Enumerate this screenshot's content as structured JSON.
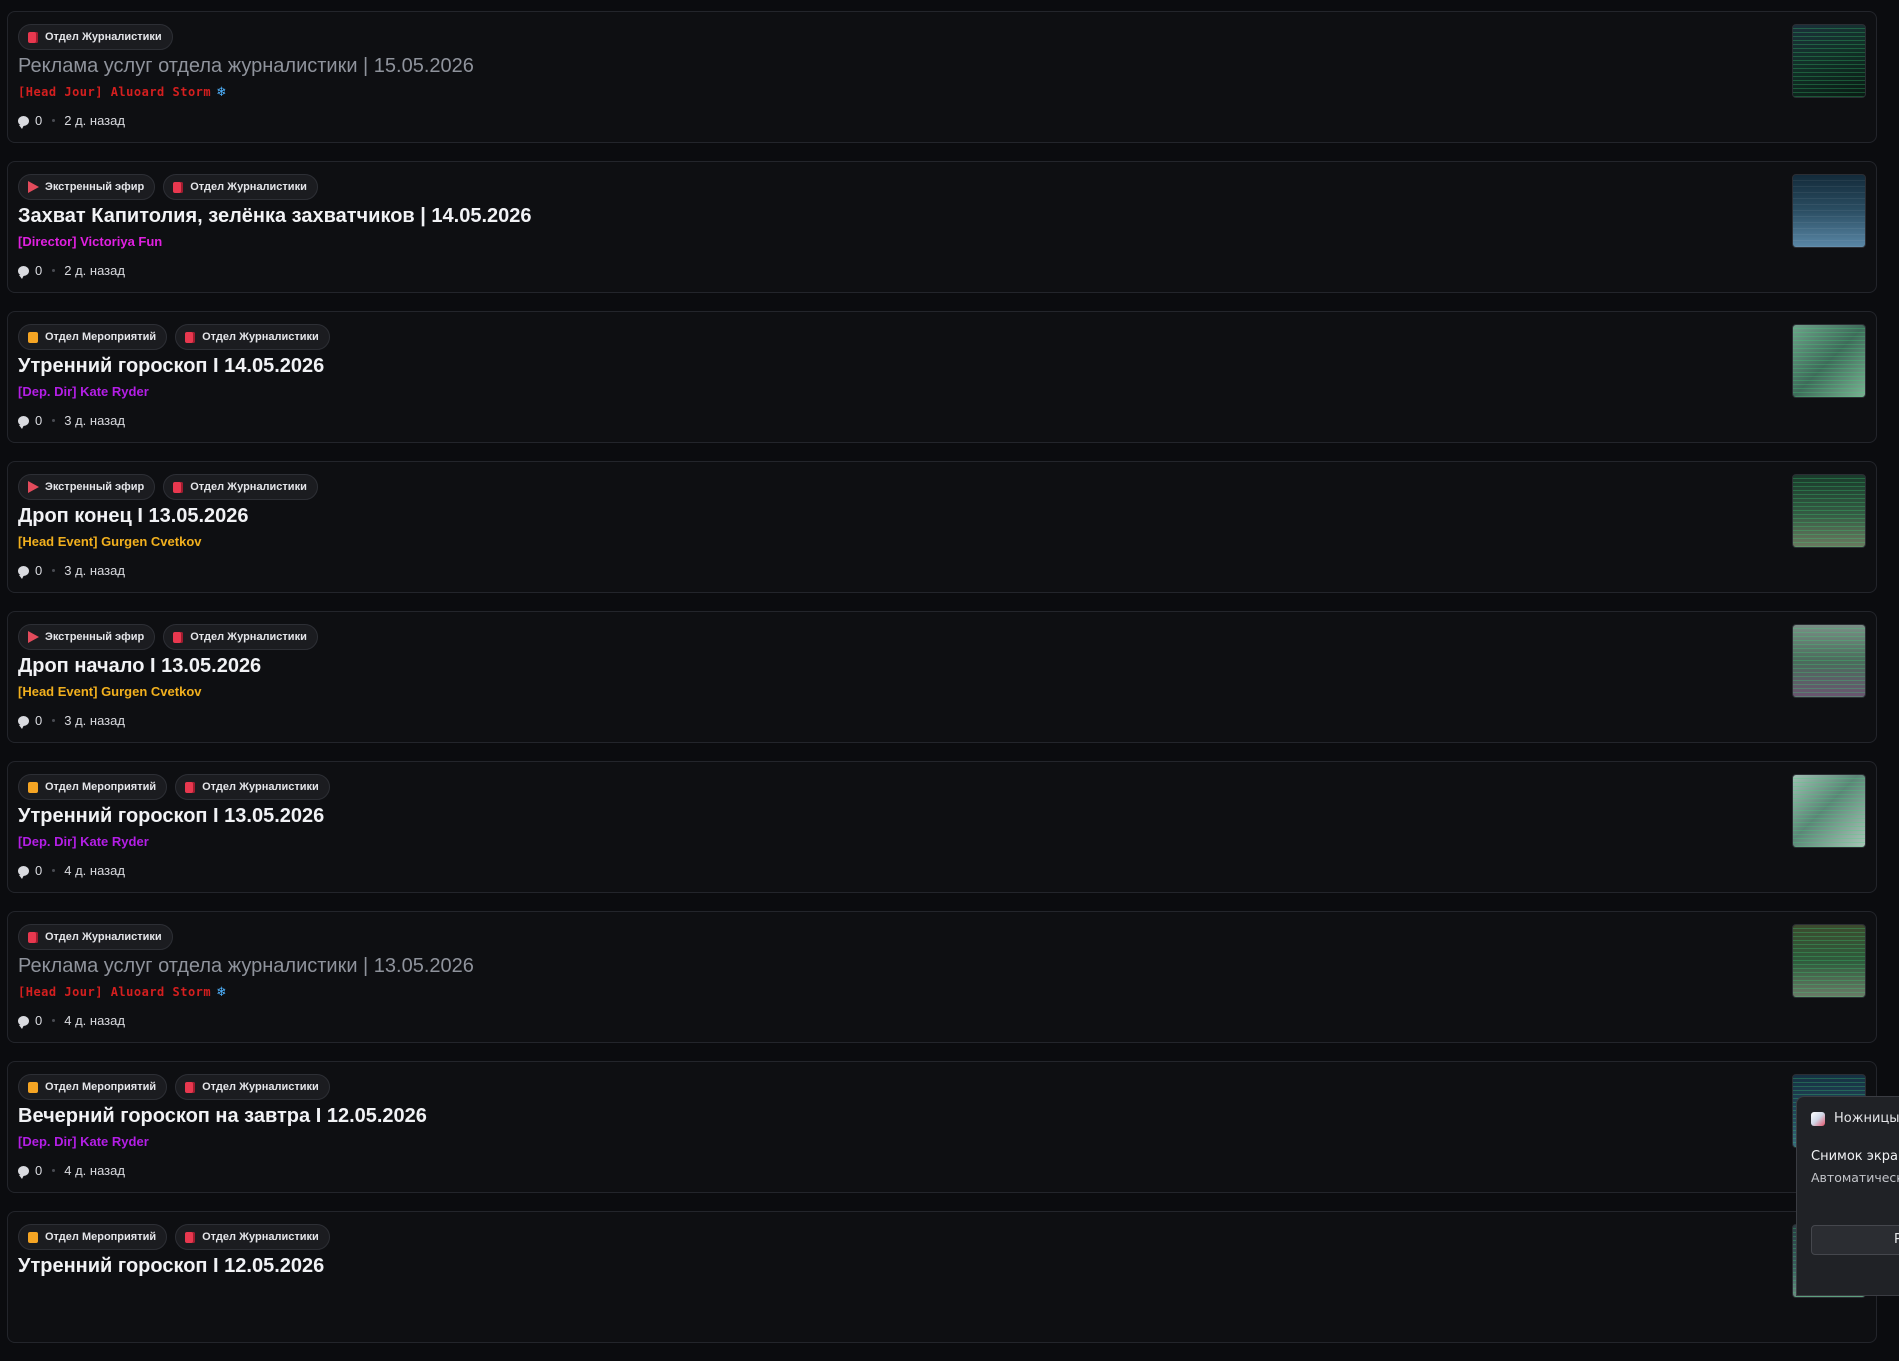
{
  "tags": {
    "journalism": {
      "label": "Отдел Журналистики",
      "icon": "book-icon",
      "color": "#e8384f"
    },
    "events": {
      "label": "Отдел Мероприятий",
      "icon": "folder-icon",
      "color": "#f5a524"
    },
    "emergency": {
      "label": "Экстренный эфир",
      "icon": "megaphone-icon",
      "color": "#e34b5c"
    }
  },
  "posts": [
    {
      "tags": [
        "journalism"
      ],
      "title": "Реклама услуг отдела журналистики | 15.05.2026",
      "title_read": true,
      "author": "[Head Jour] Aluoard Storm",
      "author_color": "#d41f1f",
      "author_icon": "❄",
      "comments": "0",
      "time": "2 д. назад"
    },
    {
      "tags": [
        "emergency",
        "journalism"
      ],
      "title": "Захват Капитолия, зелёнка захватчиков | 14.05.2026",
      "title_read": false,
      "author": "[Director] Victoriya Fun",
      "author_color": "#e020e0",
      "comments": "0",
      "time": "2 д. назад"
    },
    {
      "tags": [
        "events",
        "journalism"
      ],
      "title": "Утренний гороскоп I 14.05.2026",
      "title_read": false,
      "author": "[Dep. Dir] Kate Ryder",
      "author_color": "#b41ee6",
      "comments": "0",
      "time": "3 д. назад"
    },
    {
      "tags": [
        "emergency",
        "journalism"
      ],
      "title": "Дроп конец I 13.05.2026",
      "title_read": false,
      "author": "[Head Event] Gurgen Cvetkov",
      "author_color": "#f2b01e",
      "comments": "0",
      "time": "3 д. назад"
    },
    {
      "tags": [
        "emergency",
        "journalism"
      ],
      "title": "Дроп начало I 13.05.2026",
      "title_read": false,
      "author": "[Head Event] Gurgen Cvetkov",
      "author_color": "#f2b01e",
      "comments": "0",
      "time": "3 д. назад"
    },
    {
      "tags": [
        "events",
        "journalism"
      ],
      "title": "Утренний гороскоп I 13.05.2026",
      "title_read": false,
      "author": "[Dep. Dir] Kate Ryder",
      "author_color": "#b41ee6",
      "comments": "0",
      "time": "4 д. назад"
    },
    {
      "tags": [
        "journalism"
      ],
      "title": "Реклама услуг отдела журналистики | 13.05.2026",
      "title_read": true,
      "author": "[Head Jour] Aluoard Storm",
      "author_color": "#d41f1f",
      "author_icon": "❄",
      "comments": "0",
      "time": "4 д. назад"
    },
    {
      "tags": [
        "events",
        "journalism"
      ],
      "title": "Вечерний гороскоп на завтра I 12.05.2026",
      "title_read": false,
      "author": "[Dep. Dir] Kate Ryder",
      "author_color": "#b41ee6",
      "comments": "0",
      "time": "4 д. назад"
    },
    {
      "tags": [
        "events",
        "journalism"
      ],
      "title": "Утренний гороскоп I 12.05.2026",
      "title_read": false,
      "author": "",
      "author_color": "#b41ee6",
      "comments": "",
      "time": ""
    }
  ],
  "notification": {
    "app_name": "Ножницы",
    "title": "Снимок экран",
    "body": "Автоматическ экрана.",
    "button_label": "Р"
  }
}
